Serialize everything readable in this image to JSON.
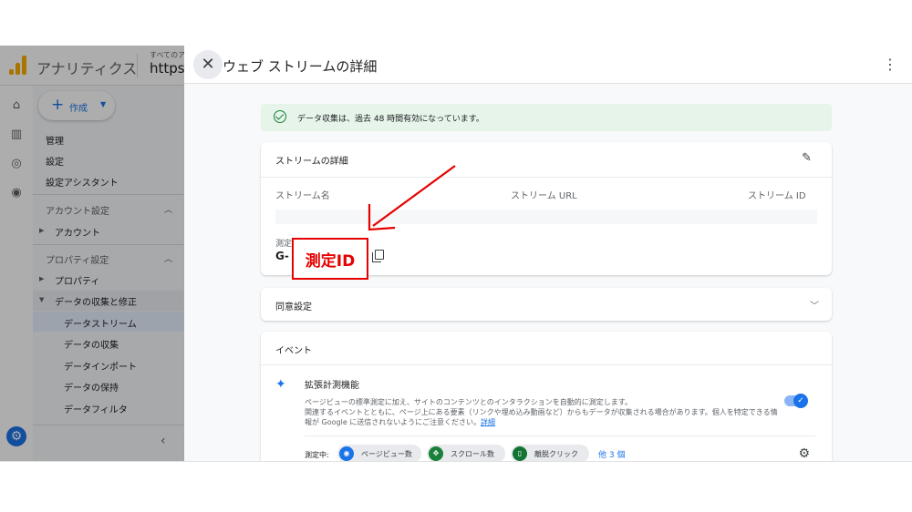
{
  "app": {
    "name": "アナリティクス",
    "account_small": "すべてのア",
    "account_big": "https:"
  },
  "nav": {
    "create_label": "作成",
    "items": [
      "管理",
      "設定",
      "設定アシスタント"
    ],
    "account_section": "アカウント設定",
    "account_item": "アカウント",
    "property_section": "プロパティ設定",
    "property_item": "プロパティ",
    "data_group": "データの収集と修正",
    "data_sub": [
      "データストリーム",
      "データの収集",
      "データインポート",
      "データの保持",
      "データフィルタ"
    ]
  },
  "panel": {
    "title": "ウェブ ストリームの詳細",
    "banner": "データ収集は、過去 48 時間有効になっています。",
    "stream_card": {
      "title": "ストリームの詳細",
      "col_name": "ストリーム名",
      "col_url": "ストリーム URL",
      "col_id": "ストリーム ID",
      "measurement_label": "測定",
      "measurement_value": "G-"
    },
    "consent_card": {
      "title": "同意設定"
    },
    "events_card": {
      "title": "イベント",
      "feature_title": "拡張計測機能",
      "feature_desc_1": "ページビューの標準測定に加え、サイトのコンテンツとのインタラクションを自動的に測定します。",
      "feature_desc_2": "関連するイベントとともに、ページ上にある要素（リンクや埋め込み動画など）からもデータが収集される場合があります。個人を特定できる情",
      "feature_desc_3": "報が Google に送信されないようにご注意ください。",
      "feature_link": "詳細",
      "measuring_label": "測定中:",
      "chips": [
        "ページビュー数",
        "スクロール数",
        "離脱クリック"
      ],
      "more": "他 3 個"
    }
  },
  "annotation": {
    "label": "測定ID",
    "color": "#e60000"
  },
  "colors": {
    "accent": "#1a73e8",
    "success_bg": "#e6f4ea",
    "ga_orange": "#f9ab00"
  }
}
